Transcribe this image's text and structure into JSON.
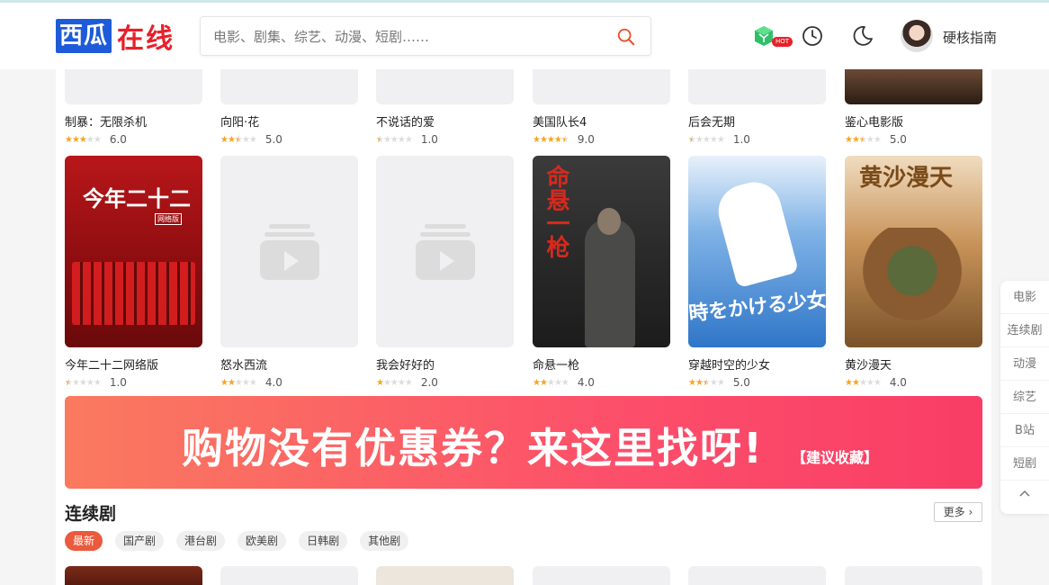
{
  "header": {
    "logo_part1": "西瓜",
    "logo_part2": "在线",
    "search_placeholder": "电影、剧集、综艺、动漫、短剧……",
    "hot_badge": "HOT",
    "username": "硬核指南",
    "icons": [
      "search-icon",
      "cube-icon",
      "history-clock-icon",
      "dark-mode-moon-icon"
    ]
  },
  "row1": [
    {
      "title": "制暴：无限杀机",
      "rating": 6.0,
      "score": "6.0"
    },
    {
      "title": "向阳·花",
      "rating": 5.0,
      "score": "5.0"
    },
    {
      "title": "不说话的爱",
      "rating": 1.0,
      "score": "1.0"
    },
    {
      "title": "美国队长4",
      "rating": 9.0,
      "score": "9.0"
    },
    {
      "title": "后会无期",
      "rating": 1.0,
      "score": "1.0"
    },
    {
      "title": "鉴心电影版",
      "rating": 5.0,
      "score": "5.0"
    }
  ],
  "row2": [
    {
      "title": "今年二十二网络版",
      "rating": 1.0,
      "score": "1.0",
      "poster_text": "今年二十二",
      "poster_sub": "网络版"
    },
    {
      "title": "怒水西流",
      "rating": 4.0,
      "score": "4.0"
    },
    {
      "title": "我会好好的",
      "rating": 2.0,
      "score": "2.0"
    },
    {
      "title": "命悬一枪",
      "rating": 4.0,
      "score": "4.0",
      "poster_text": "命悬一枪"
    },
    {
      "title": "穿越时空的少女",
      "rating": 5.0,
      "score": "5.0",
      "poster_text": "時をかける少女"
    },
    {
      "title": "黄沙漫天",
      "rating": 4.0,
      "score": "4.0",
      "poster_text": "黄沙漫天"
    }
  ],
  "banner": {
    "main_text": "购物没有优惠券？来这里找呀!",
    "sub_text": "【建议收藏】"
  },
  "section": {
    "title": "连续剧",
    "more_label": "更多",
    "tabs": [
      "最新",
      "国产剧",
      "港台剧",
      "欧美剧",
      "日韩剧",
      "其他剧"
    ]
  },
  "sidenav": [
    "电影",
    "连续剧",
    "动漫",
    "综艺",
    "B站",
    "短剧"
  ],
  "colors": {
    "accent": "#ea5a3c",
    "star": "#f5a623",
    "logo_blue": "#1e5bd8",
    "logo_red": "#e8202a"
  }
}
